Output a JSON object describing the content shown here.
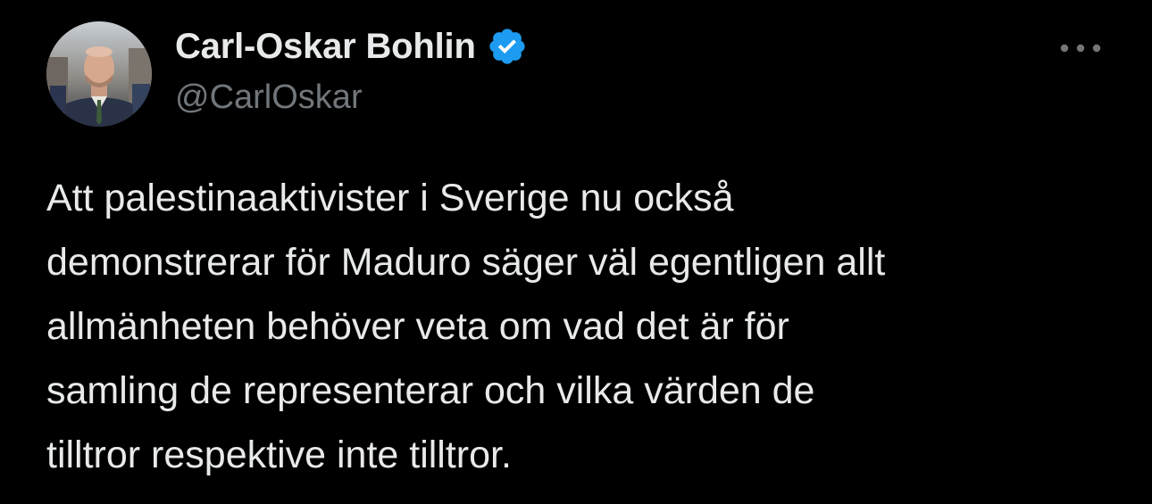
{
  "tweet": {
    "author": {
      "display_name": "Carl-Oskar Bohlin",
      "handle": "@CarlOskar",
      "verified": true,
      "verified_icon": "verified-badge-icon",
      "avatar": "avatar-photo"
    },
    "more_icon": "more-options-icon",
    "text": "Att palestinaaktivister i Sverige nu också\ndemonstrerar för Maduro säger väl egentligen allt\nallmänheten behöver veta om vad det är för\nsamling de representerar och vilka värden de\ntilltror respektive inte tilltror."
  },
  "colors": {
    "background": "#000000",
    "primary_text": "#e7e9ea",
    "secondary_text": "#71767b",
    "verified_blue": "#1d9bf0"
  }
}
